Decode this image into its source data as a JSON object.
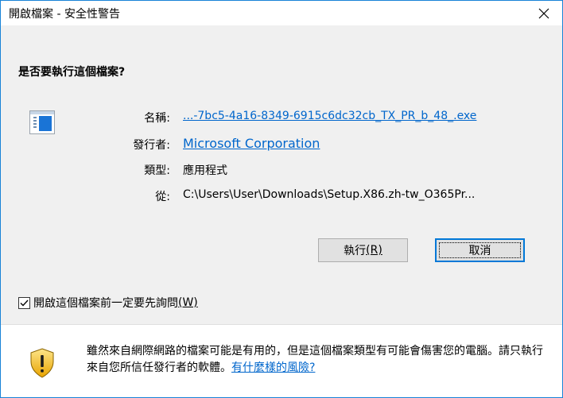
{
  "window": {
    "title": "開啟檔案 - 安全性警告",
    "close_glyph": "✕"
  },
  "dialog": {
    "question": "是否要執行這個檔案?",
    "fields": {
      "name_label": "名稱:",
      "name_value": "...-7bc5-4a16-8349-6915c6dc32cb_TX_PR_b_48_.exe",
      "publisher_label": "發行者:",
      "publisher_value": "Microsoft Corporation",
      "type_label": "類型:",
      "type_value": "應用程式",
      "from_label": "從:",
      "from_value": "C:\\Users\\User\\Downloads\\Setup.X86.zh-tw_O365Pr..."
    },
    "buttons": {
      "run_label": "執行",
      "run_accel": "(R)",
      "cancel_label": "取消"
    },
    "checkbox": {
      "label": "開啟這個檔案前一定要先詢問",
      "accel": "(W)",
      "checked": true
    }
  },
  "footer": {
    "warning_text": "雖然來自網際網路的檔案可能是有用的，但是這個檔案類型有可能會傷害您的電腦。請只執行來自您所信任發行者的軟體。",
    "risk_link": "有什麼樣的風險?"
  },
  "colors": {
    "accent": "#0078d7",
    "link": "#0066cc",
    "dialog_bg": "#f0f0f0"
  }
}
